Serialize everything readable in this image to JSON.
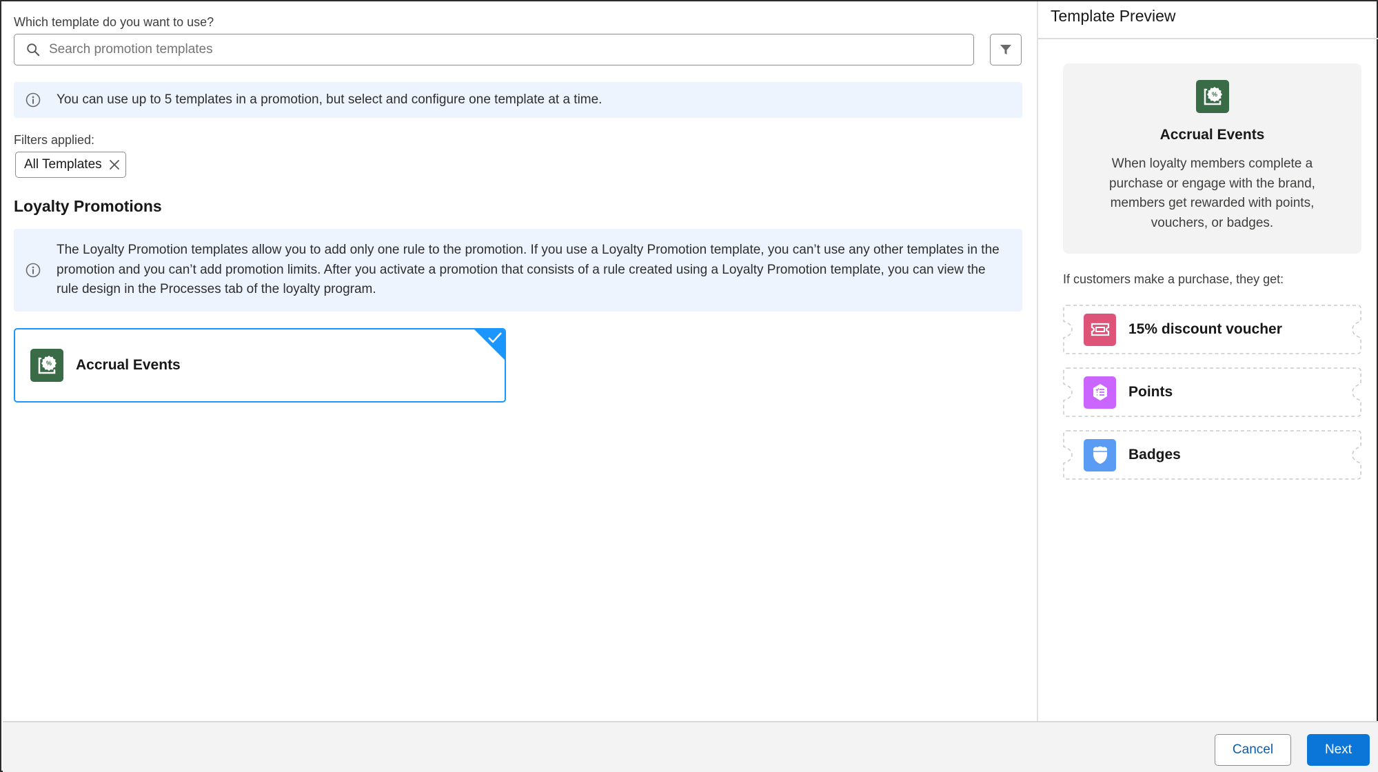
{
  "left": {
    "question_label": "Which template do you want to use?",
    "search": {
      "placeholder": "Search promotion templates",
      "value": ""
    },
    "filter_button_icon": "filter-icon",
    "info_banner": "You can use up to 5 templates in a promotion, but select and configure one template at a time.",
    "filters_label": "Filters applied:",
    "filter_pill": {
      "label": "All Templates",
      "remove_icon": "close-icon"
    },
    "section_title": "Loyalty Promotions",
    "section_info": "The Loyalty Promotion templates allow you to add only one rule to the promotion. If you use a Loyalty Promotion template, you can’t use any other templates in the promotion and you can’t add promotion limits. After you activate a promotion that consists of a rule created using a Loyalty Promotion template, you can view the rule design in the Processes tab of the loyalty program.",
    "templates": [
      {
        "name": "Accrual Events",
        "icon": "accrual-events-icon",
        "selected": true
      }
    ]
  },
  "preview": {
    "title": "Template Preview",
    "template_name": "Accrual Events",
    "description": "When loyalty members complete a purchase or engage with the brand, members get rewarded with points, vouchers, or badges.",
    "rewards_label": "If customers make a purchase, they get:",
    "rewards": [
      {
        "label": "15% discount voucher",
        "icon": "voucher-icon",
        "color": "#dd5478"
      },
      {
        "label": "Points",
        "icon": "points-icon",
        "color": "#cb65ff"
      },
      {
        "label": "Badges",
        "icon": "badge-icon",
        "color": "#5a9cf3"
      }
    ]
  },
  "colors": {
    "accent": "#1b96ff",
    "brand_green": "#3a6b47",
    "primary_button": "#0b76d8"
  },
  "footer": {
    "cancel_label": "Cancel",
    "next_label": "Next"
  }
}
